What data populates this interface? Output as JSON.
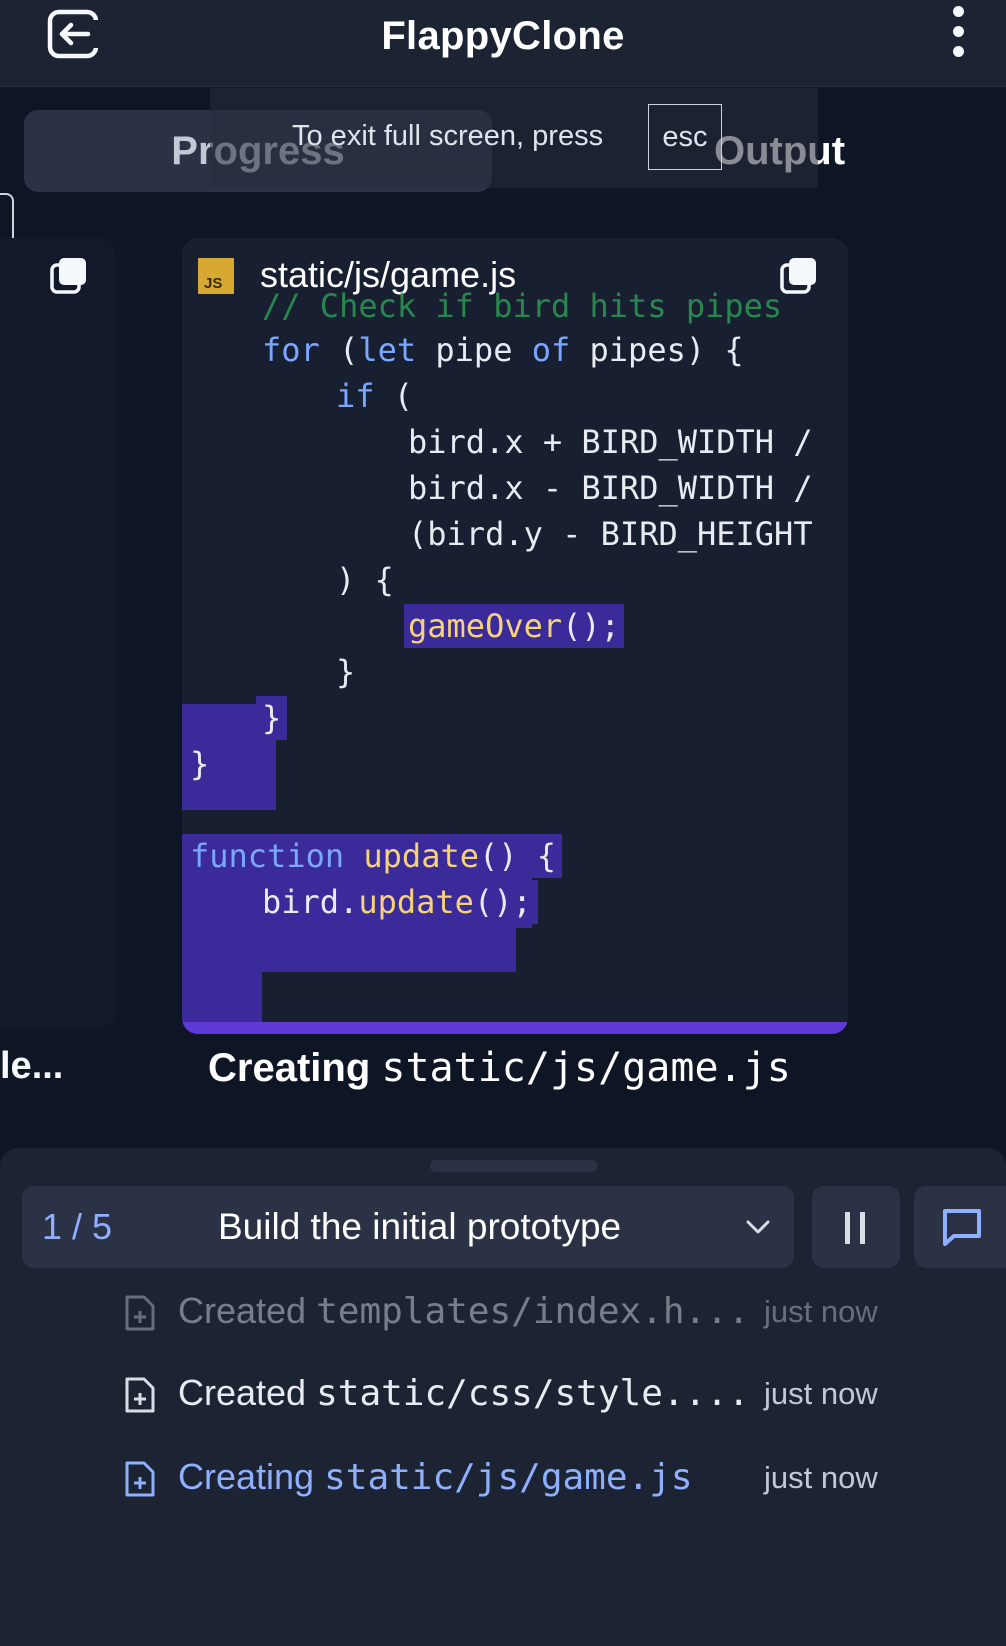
{
  "header": {
    "title": "FlappyClone",
    "exit_icon": "exit-icon",
    "menu_icon": "kebab-menu-icon"
  },
  "tabs": {
    "progress_label": "Progress",
    "output_label": "Output"
  },
  "fullscreen_toast": {
    "text": "To exit full screen, press",
    "key": "esc"
  },
  "left_card": {
    "caption": "le..."
  },
  "code_card": {
    "file_badge": "JS",
    "file_name": "static/js/game.js",
    "copy_icon": "copy-icon",
    "lines": {
      "l1": "// Check if bird hits pipes",
      "l2_for": "for",
      "l2_let": "let",
      "l2_pipe": " pipe ",
      "l2_of": "of",
      "l2_rest": " pipes) {",
      "l3_if": "if",
      "l3_rest": " (",
      "l4": "bird.x + BIRD_WIDTH /",
      "l5": "bird.x - BIRD_WIDTH /",
      "l6": "(bird.y - BIRD_HEIGHT",
      "l7": ") {",
      "l8_fn": "gameOver",
      "l8_rest": "();",
      "l9": "}",
      "l10": "}",
      "l11": "}",
      "l13_kw": "function",
      "l13_fn": " update",
      "l13_rest": "() {",
      "l14_obj": "bird.",
      "l14_fn": "update",
      "l14_rest": "();"
    }
  },
  "caption": {
    "label": "Creating",
    "path": "static/js/game.js"
  },
  "step": {
    "counter": "1 / 5",
    "title": "Build the initial prototype",
    "chevron_icon": "chevron-down-icon",
    "pause_icon": "pause-icon",
    "chat_icon": "chat-icon"
  },
  "activity": [
    {
      "verb": "Created",
      "path": "templates/index.h...",
      "time": "just now",
      "state": "faded",
      "icon": "file-add-icon"
    },
    {
      "verb": "Created",
      "path": "static/css/style....",
      "time": "just now",
      "state": "done",
      "icon": "file-add-icon"
    },
    {
      "verb": "Creating",
      "path": "static/js/game.js",
      "time": "just now",
      "state": "active",
      "icon": "file-add-icon"
    }
  ],
  "colors": {
    "background": "#0e1525",
    "surface": "#1c2333",
    "surface_raised": "#2b3245",
    "highlight": "#3a2a9a",
    "accent_blue": "#8fb0ff",
    "keyword": "#7aa7ff",
    "function": "#f6d27a",
    "comment": "#2c9a53",
    "js_badge": "#d7a933",
    "bottom_glow": "#5e39d6"
  }
}
